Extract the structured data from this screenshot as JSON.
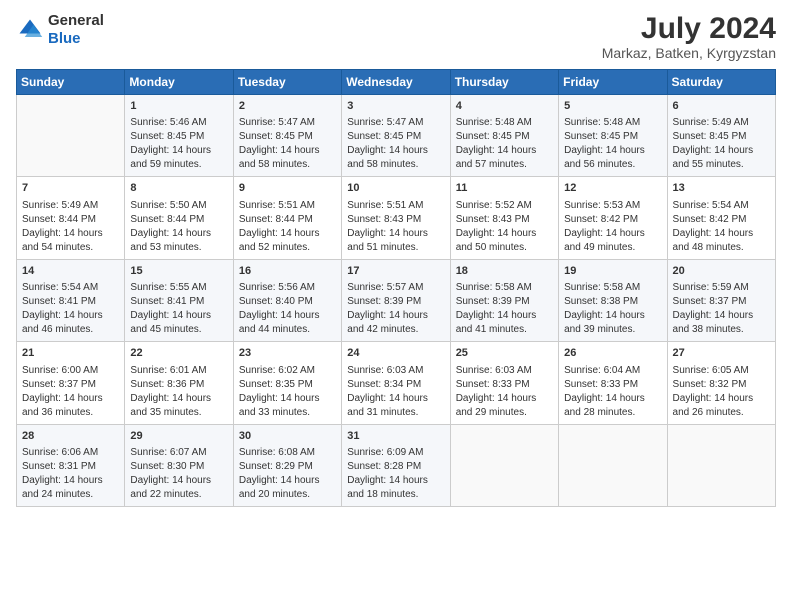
{
  "logo": {
    "general": "General",
    "blue": "Blue"
  },
  "title": "July 2024",
  "location": "Markaz, Batken, Kyrgyzstan",
  "days_of_week": [
    "Sunday",
    "Monday",
    "Tuesday",
    "Wednesday",
    "Thursday",
    "Friday",
    "Saturday"
  ],
  "weeks": [
    [
      {
        "day": "",
        "lines": []
      },
      {
        "day": "1",
        "lines": [
          "Sunrise: 5:46 AM",
          "Sunset: 8:45 PM",
          "Daylight: 14 hours",
          "and 59 minutes."
        ]
      },
      {
        "day": "2",
        "lines": [
          "Sunrise: 5:47 AM",
          "Sunset: 8:45 PM",
          "Daylight: 14 hours",
          "and 58 minutes."
        ]
      },
      {
        "day": "3",
        "lines": [
          "Sunrise: 5:47 AM",
          "Sunset: 8:45 PM",
          "Daylight: 14 hours",
          "and 58 minutes."
        ]
      },
      {
        "day": "4",
        "lines": [
          "Sunrise: 5:48 AM",
          "Sunset: 8:45 PM",
          "Daylight: 14 hours",
          "and 57 minutes."
        ]
      },
      {
        "day": "5",
        "lines": [
          "Sunrise: 5:48 AM",
          "Sunset: 8:45 PM",
          "Daylight: 14 hours",
          "and 56 minutes."
        ]
      },
      {
        "day": "6",
        "lines": [
          "Sunrise: 5:49 AM",
          "Sunset: 8:45 PM",
          "Daylight: 14 hours",
          "and 55 minutes."
        ]
      }
    ],
    [
      {
        "day": "7",
        "lines": [
          "Sunrise: 5:49 AM",
          "Sunset: 8:44 PM",
          "Daylight: 14 hours",
          "and 54 minutes."
        ]
      },
      {
        "day": "8",
        "lines": [
          "Sunrise: 5:50 AM",
          "Sunset: 8:44 PM",
          "Daylight: 14 hours",
          "and 53 minutes."
        ]
      },
      {
        "day": "9",
        "lines": [
          "Sunrise: 5:51 AM",
          "Sunset: 8:44 PM",
          "Daylight: 14 hours",
          "and 52 minutes."
        ]
      },
      {
        "day": "10",
        "lines": [
          "Sunrise: 5:51 AM",
          "Sunset: 8:43 PM",
          "Daylight: 14 hours",
          "and 51 minutes."
        ]
      },
      {
        "day": "11",
        "lines": [
          "Sunrise: 5:52 AM",
          "Sunset: 8:43 PM",
          "Daylight: 14 hours",
          "and 50 minutes."
        ]
      },
      {
        "day": "12",
        "lines": [
          "Sunrise: 5:53 AM",
          "Sunset: 8:42 PM",
          "Daylight: 14 hours",
          "and 49 minutes."
        ]
      },
      {
        "day": "13",
        "lines": [
          "Sunrise: 5:54 AM",
          "Sunset: 8:42 PM",
          "Daylight: 14 hours",
          "and 48 minutes."
        ]
      }
    ],
    [
      {
        "day": "14",
        "lines": [
          "Sunrise: 5:54 AM",
          "Sunset: 8:41 PM",
          "Daylight: 14 hours",
          "and 46 minutes."
        ]
      },
      {
        "day": "15",
        "lines": [
          "Sunrise: 5:55 AM",
          "Sunset: 8:41 PM",
          "Daylight: 14 hours",
          "and 45 minutes."
        ]
      },
      {
        "day": "16",
        "lines": [
          "Sunrise: 5:56 AM",
          "Sunset: 8:40 PM",
          "Daylight: 14 hours",
          "and 44 minutes."
        ]
      },
      {
        "day": "17",
        "lines": [
          "Sunrise: 5:57 AM",
          "Sunset: 8:39 PM",
          "Daylight: 14 hours",
          "and 42 minutes."
        ]
      },
      {
        "day": "18",
        "lines": [
          "Sunrise: 5:58 AM",
          "Sunset: 8:39 PM",
          "Daylight: 14 hours",
          "and 41 minutes."
        ]
      },
      {
        "day": "19",
        "lines": [
          "Sunrise: 5:58 AM",
          "Sunset: 8:38 PM",
          "Daylight: 14 hours",
          "and 39 minutes."
        ]
      },
      {
        "day": "20",
        "lines": [
          "Sunrise: 5:59 AM",
          "Sunset: 8:37 PM",
          "Daylight: 14 hours",
          "and 38 minutes."
        ]
      }
    ],
    [
      {
        "day": "21",
        "lines": [
          "Sunrise: 6:00 AM",
          "Sunset: 8:37 PM",
          "Daylight: 14 hours",
          "and 36 minutes."
        ]
      },
      {
        "day": "22",
        "lines": [
          "Sunrise: 6:01 AM",
          "Sunset: 8:36 PM",
          "Daylight: 14 hours",
          "and 35 minutes."
        ]
      },
      {
        "day": "23",
        "lines": [
          "Sunrise: 6:02 AM",
          "Sunset: 8:35 PM",
          "Daylight: 14 hours",
          "and 33 minutes."
        ]
      },
      {
        "day": "24",
        "lines": [
          "Sunrise: 6:03 AM",
          "Sunset: 8:34 PM",
          "Daylight: 14 hours",
          "and 31 minutes."
        ]
      },
      {
        "day": "25",
        "lines": [
          "Sunrise: 6:03 AM",
          "Sunset: 8:33 PM",
          "Daylight: 14 hours",
          "and 29 minutes."
        ]
      },
      {
        "day": "26",
        "lines": [
          "Sunrise: 6:04 AM",
          "Sunset: 8:33 PM",
          "Daylight: 14 hours",
          "and 28 minutes."
        ]
      },
      {
        "day": "27",
        "lines": [
          "Sunrise: 6:05 AM",
          "Sunset: 8:32 PM",
          "Daylight: 14 hours",
          "and 26 minutes."
        ]
      }
    ],
    [
      {
        "day": "28",
        "lines": [
          "Sunrise: 6:06 AM",
          "Sunset: 8:31 PM",
          "Daylight: 14 hours",
          "and 24 minutes."
        ]
      },
      {
        "day": "29",
        "lines": [
          "Sunrise: 6:07 AM",
          "Sunset: 8:30 PM",
          "Daylight: 14 hours",
          "and 22 minutes."
        ]
      },
      {
        "day": "30",
        "lines": [
          "Sunrise: 6:08 AM",
          "Sunset: 8:29 PM",
          "Daylight: 14 hours",
          "and 20 minutes."
        ]
      },
      {
        "day": "31",
        "lines": [
          "Sunrise: 6:09 AM",
          "Sunset: 8:28 PM",
          "Daylight: 14 hours",
          "and 18 minutes."
        ]
      },
      {
        "day": "",
        "lines": []
      },
      {
        "day": "",
        "lines": []
      },
      {
        "day": "",
        "lines": []
      }
    ]
  ]
}
